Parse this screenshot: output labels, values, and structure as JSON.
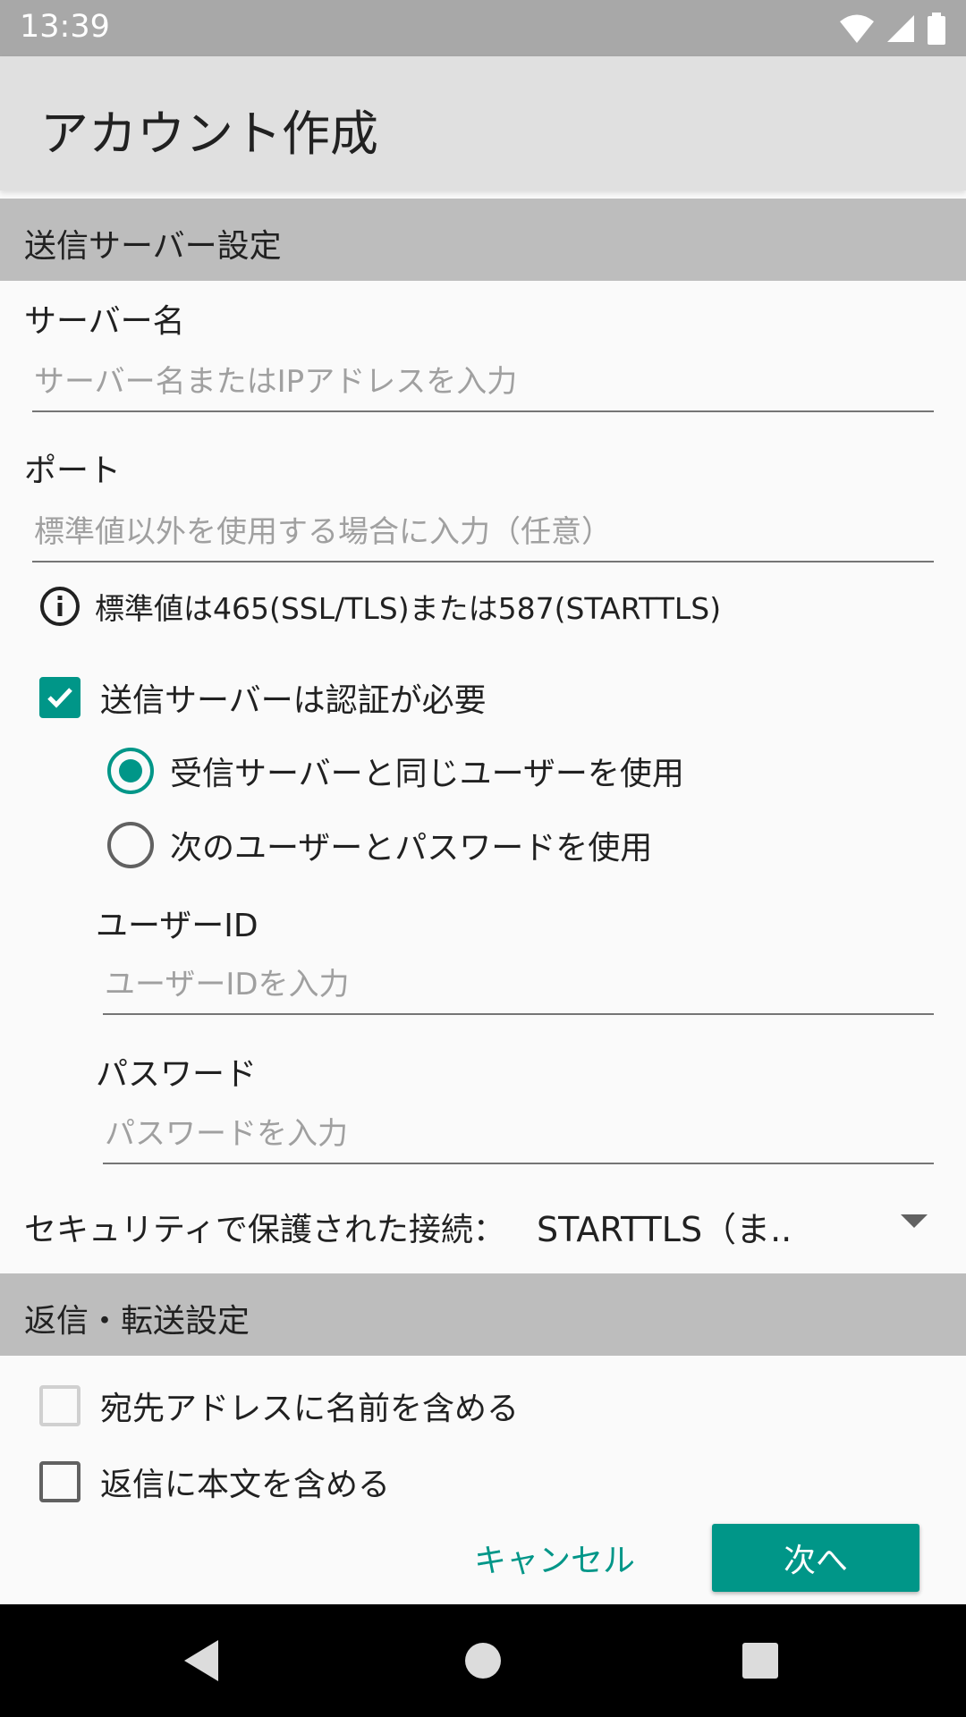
{
  "status_bar": {
    "time": "13:39"
  },
  "app_bar": {
    "title": "アカウント作成"
  },
  "outgoing_section": {
    "header": "送信サーバー設定",
    "server_name_label": "サーバー名",
    "server_name_placeholder": "サーバー名またはIPアドレスを入力",
    "server_name_value": "",
    "port_label": "ポート",
    "port_placeholder": "標準値以外を使用する場合に入力（任意）",
    "port_value": "",
    "port_info": "標準値は465(SSL/TLS)または587(STARTTLS)",
    "auth_required_label": "送信サーバーは認証が必要",
    "auth_required_checked": true,
    "auth_options": [
      {
        "label": "受信サーバーと同じユーザーを使用",
        "selected": true
      },
      {
        "label": "次のユーザーとパスワードを使用",
        "selected": false
      }
    ],
    "user_id_label": "ユーザーID",
    "user_id_placeholder": "ユーザーIDを入力",
    "password_label": "パスワード",
    "password_placeholder": "パスワードを入力",
    "security_label": "セキュリティで保護された接続：",
    "security_value": "STARTTLS（ま.."
  },
  "reply_section": {
    "header": "返信・転送設定",
    "include_name_label": "宛先アドレスに名前を含める",
    "include_name_checked": false,
    "include_body_label": "返信に本文を含める",
    "include_body_checked": false
  },
  "buttons": {
    "cancel": "キャンセル",
    "next": "次へ"
  },
  "colors": {
    "accent": "#009688",
    "status_bar": "#a8a8a8",
    "app_bar": "#e0e0e0",
    "section_header": "#bdbdbd"
  }
}
